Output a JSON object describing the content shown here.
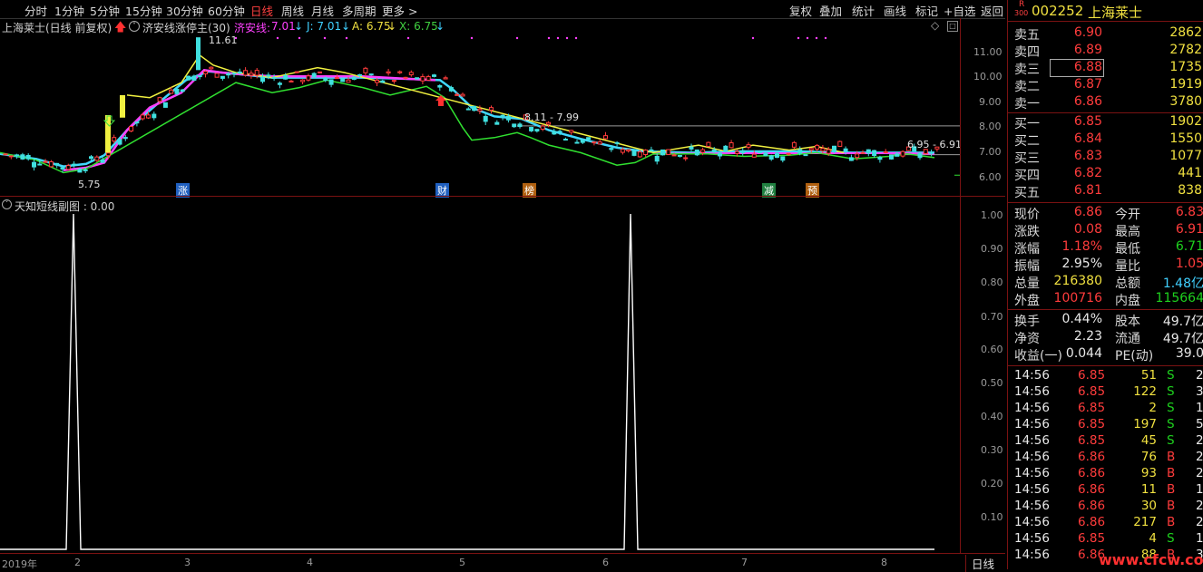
{
  "toolbar": {
    "periods": [
      "分时",
      "1分钟",
      "5分钟",
      "15分钟",
      "30分钟",
      "60分钟",
      "日线",
      "周线",
      "月线",
      "多周期",
      "更多 >"
    ],
    "active_period": "日线",
    "right_items": [
      "复权",
      "叠加",
      "统计",
      "画线",
      "标记",
      "+自选",
      "返回"
    ]
  },
  "info": {
    "title": "上海莱士(日线 前复权)",
    "formula": "济安线涨停主(30)",
    "line_name": "济安线:",
    "line_val": "7.01",
    "j": "J: 7.01",
    "a": "A: 6.75",
    "x": "X: 6.75"
  },
  "main_chart": {
    "high_label": "11.61",
    "low_label": "5.75",
    "range_label": "8.11 - 7.99",
    "end_label": "6.95 - 6.91",
    "y_ticks": [
      "11.00",
      "10.00",
      "9.00",
      "8.00",
      "7.00",
      "6.00"
    ],
    "markers": [
      {
        "text": "涨",
        "color": "#2060c0"
      },
      {
        "text": "财",
        "color": "#2060c0"
      },
      {
        "text": "榜",
        "color": "#b06010"
      },
      {
        "text": "减",
        "color": "#208040"
      },
      {
        "text": "预",
        "color": "#b06010"
      }
    ]
  },
  "sub_chart": {
    "title": "天知短线副图 : 0.00",
    "y_ticks": [
      "1.00",
      "0.90",
      "0.80",
      "0.70",
      "0.60",
      "0.50",
      "0.40",
      "0.30",
      "0.20",
      "0.10"
    ]
  },
  "x_axis": {
    "labels": [
      "2019年",
      "2",
      "3",
      "4",
      "5",
      "6",
      "7",
      "8"
    ],
    "period_tab": "日线"
  },
  "panel": {
    "code_prefix_top": "R",
    "code_prefix_bottom": "300",
    "code": "002252",
    "name": "上海莱士",
    "asks": [
      {
        "label": "卖五",
        "price": "6.90",
        "vol": "2862"
      },
      {
        "label": "卖四",
        "price": "6.89",
        "vol": "2782"
      },
      {
        "label": "卖三",
        "price": "6.88",
        "vol": "1735"
      },
      {
        "label": "卖二",
        "price": "6.87",
        "vol": "1919"
      },
      {
        "label": "卖一",
        "price": "6.86",
        "vol": "3780"
      }
    ],
    "bids": [
      {
        "label": "买一",
        "price": "6.85",
        "vol": "1902"
      },
      {
        "label": "买二",
        "price": "6.84",
        "vol": "1550"
      },
      {
        "label": "买三",
        "price": "6.83",
        "vol": "1077"
      },
      {
        "label": "买四",
        "price": "6.82",
        "vol": "441"
      },
      {
        "label": "买五",
        "price": "6.81",
        "vol": "838"
      }
    ],
    "stats": [
      {
        "l1": "现价",
        "v1": "6.86",
        "c1": "red",
        "l2": "今开",
        "v2": "6.83",
        "c2": "red"
      },
      {
        "l1": "涨跌",
        "v1": "0.08",
        "c1": "red",
        "l2": "最高",
        "v2": "6.91",
        "c2": "red"
      },
      {
        "l1": "涨幅",
        "v1": "1.18%",
        "c1": "red",
        "l2": "最低",
        "v2": "6.71",
        "c2": "green"
      },
      {
        "l1": "振幅",
        "v1": "2.95%",
        "c1": "white",
        "l2": "量比",
        "v2": "1.05",
        "c2": "red"
      },
      {
        "l1": "总量",
        "v1": "216380",
        "c1": "yellow",
        "l2": "总额",
        "v2": "1.48亿",
        "c2": "cyan"
      },
      {
        "l1": "外盘",
        "v1": "100716",
        "c1": "red",
        "l2": "内盘",
        "v2": "115664",
        "c2": "green"
      }
    ],
    "stats2": [
      {
        "l1": "换手",
        "v1": "0.44%",
        "c1": "white",
        "l2": "股本",
        "v2": "49.7亿",
        "c2": "white"
      },
      {
        "l1": "净资",
        "v1": "2.23",
        "c1": "white",
        "l2": "流通",
        "v2": "49.7亿",
        "c2": "white"
      },
      {
        "l1": "收益(一)",
        "v1": "0.044",
        "c1": "white",
        "l2": "PE(动)",
        "v2": "39.0",
        "c2": "white"
      }
    ],
    "ticks": [
      {
        "t": "14:56",
        "p": "6.85",
        "v": "51",
        "s": "S",
        "n": "2"
      },
      {
        "t": "14:56",
        "p": "6.85",
        "v": "122",
        "s": "S",
        "n": "3"
      },
      {
        "t": "14:56",
        "p": "6.85",
        "v": "2",
        "s": "S",
        "n": "1"
      },
      {
        "t": "14:56",
        "p": "6.85",
        "v": "197",
        "s": "S",
        "n": "5"
      },
      {
        "t": "14:56",
        "p": "6.85",
        "v": "45",
        "s": "S",
        "n": "2"
      },
      {
        "t": "14:56",
        "p": "6.86",
        "v": "76",
        "s": "B",
        "n": "2"
      },
      {
        "t": "14:56",
        "p": "6.86",
        "v": "93",
        "s": "B",
        "n": "2"
      },
      {
        "t": "14:56",
        "p": "6.86",
        "v": "11",
        "s": "B",
        "n": "1"
      },
      {
        "t": "14:56",
        "p": "6.86",
        "v": "30",
        "s": "B",
        "n": "2"
      },
      {
        "t": "14:56",
        "p": "6.86",
        "v": "217",
        "s": "B",
        "n": "2"
      },
      {
        "t": "14:56",
        "p": "6.85",
        "v": "4",
        "s": "S",
        "n": "1"
      },
      {
        "t": "14:56",
        "p": "6.86",
        "v": "88",
        "s": "B",
        "n": "3"
      },
      {
        "t": "14:57",
        "p": "6.86",
        "v": "7",
        "s": "B",
        "n": "1"
      }
    ],
    "watermark": "www.cfcw.com"
  }
}
